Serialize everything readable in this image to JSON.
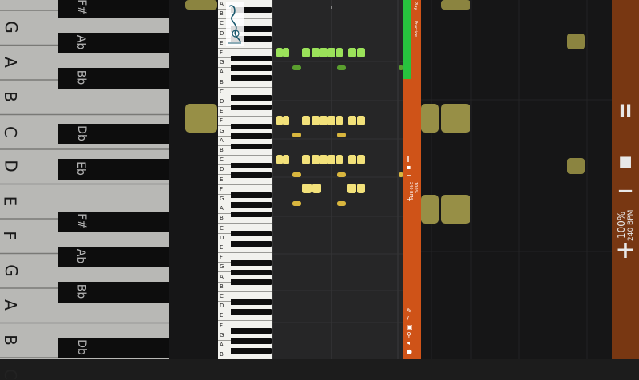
{
  "colors": {
    "note_green": "#9be25a",
    "note_green_dark": "#5a9e2e",
    "note_yellow": "#f2e17a",
    "note_yellow_dark": "#d9b63e",
    "panel_orange": "#cf5318",
    "progress_green": "#27c23e"
  },
  "keyboard": {
    "white_keys": [
      "A",
      "B",
      "C",
      "D",
      "E",
      "F",
      "G",
      "A",
      "B",
      "C",
      "D",
      "E",
      "F",
      "G",
      "A",
      "B",
      "C",
      "D",
      "E",
      "F",
      "G",
      "A",
      "B",
      "C",
      "D",
      "E",
      "F",
      "G",
      "A",
      "B",
      "C",
      "D",
      "E",
      "F",
      "G",
      "A",
      "B"
    ]
  },
  "bg_keyboard": {
    "white_labels": [
      "G",
      "A",
      "B",
      "C",
      "D",
      "E",
      "F",
      "G",
      "A",
      "B",
      "C"
    ],
    "black_labels": [
      "F#",
      "Ab",
      "Bb",
      "Db",
      "Eb",
      "F#",
      "Ab",
      "Bb",
      "Db"
    ]
  },
  "side_panel": {
    "items": [
      "Play",
      "Practice"
    ],
    "speed": "100%",
    "bpm": "240 BPM",
    "progress": 0.22
  },
  "right_controls": {
    "pause_glyph": "II",
    "stop_glyph": "■",
    "minus_glyph": "−",
    "speed": "100%",
    "bpm": "240 BPM",
    "plus_glyph": "+"
  },
  "icons": {
    "pause": "pause-icon",
    "stop": "stop-icon",
    "minus": "minus-icon",
    "plus": "plus-icon",
    "brush": "brush-icon",
    "pen": "pen-icon",
    "copy": "copy-icon",
    "pin": "pin-icon",
    "mute": "mute-icon",
    "record": "record-icon"
  }
}
